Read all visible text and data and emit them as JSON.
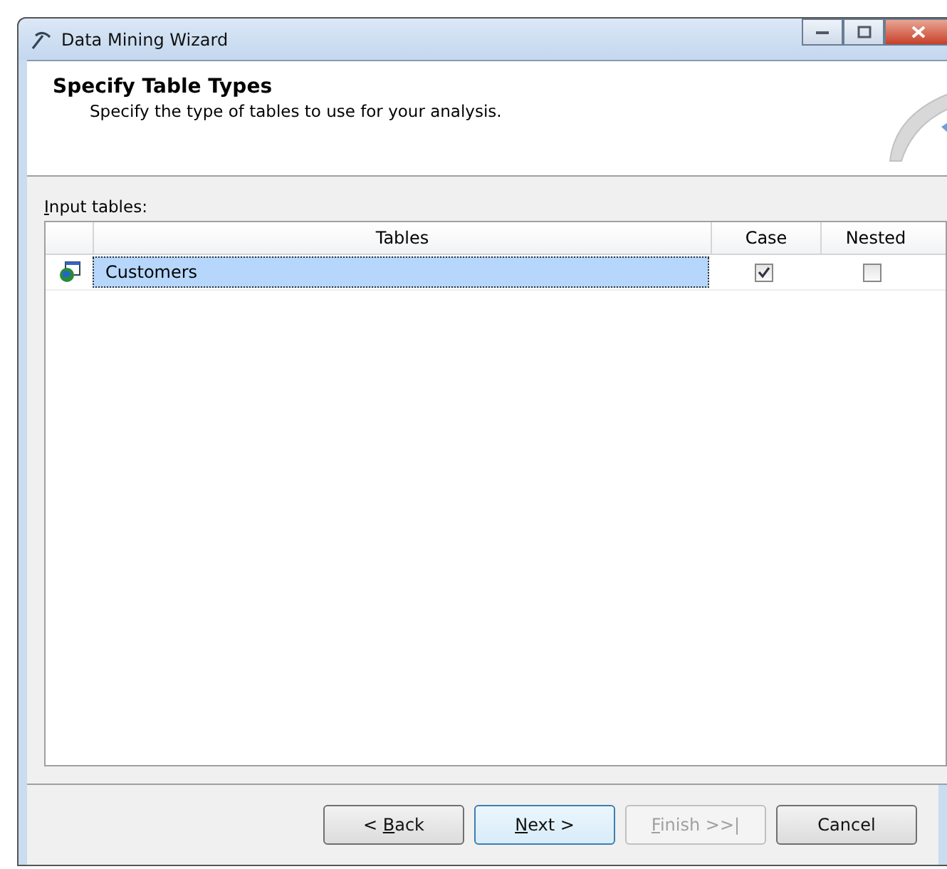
{
  "window": {
    "title": "Data Mining Wizard"
  },
  "header": {
    "title": "Specify Table Types",
    "subtitle": "Specify the type of tables to use for your analysis."
  },
  "input_tables": {
    "label": {
      "access_key": "I",
      "rest": "nput tables:"
    },
    "columns": [
      "Tables",
      "Case",
      "Nested"
    ],
    "rows": [
      {
        "name": "Customers",
        "selected": true,
        "case": true,
        "nested": false
      }
    ]
  },
  "buttons": [
    {
      "prefix": "< ",
      "access_key": "B",
      "rest": "ack",
      "disabled": false,
      "default": false
    },
    {
      "access_key": "N",
      "rest": "ext >",
      "disabled": false,
      "default": true
    },
    {
      "access_key": "F",
      "rest": "inish >>|",
      "disabled": true,
      "default": false
    },
    {
      "rest": "Cancel",
      "disabled": false,
      "default": false
    }
  ]
}
